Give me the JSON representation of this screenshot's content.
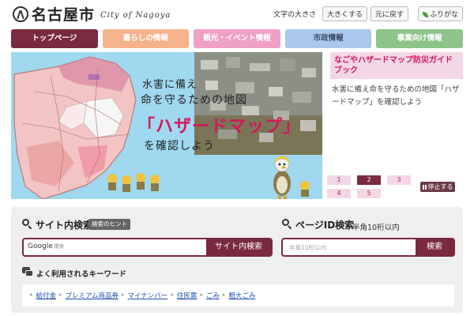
{
  "header": {
    "logo_text": "名古屋市",
    "logo_en": "City of Nagoya",
    "text_size_label": "文字の大きさ",
    "enlarge_label": "大きくする",
    "reset_label": "元に戻す",
    "furigana_label": "ふりがな"
  },
  "nav": {
    "items": [
      {
        "label": "トップページ"
      },
      {
        "label": "暮らしの情報"
      },
      {
        "label": "観光・イベント情報"
      },
      {
        "label": "市政情報"
      },
      {
        "label": "事業向け情報"
      }
    ]
  },
  "hero": {
    "line1": "水害に備え",
    "line2": "命を守るための地図",
    "line3": "「ハザードマップ」",
    "line4": "を確認しよう",
    "slide_title": "なごやハザードマップ防災ガイドブック",
    "slide_desc": "水害に備え命を守るための地図「ハザードマップ」を確認しよう",
    "pages": [
      "1",
      "2",
      "3",
      "4",
      "5"
    ],
    "active_page": 2,
    "stop_label": "停止する"
  },
  "site_search": {
    "title": "サイト内検索",
    "hint_label": "検索のヒント",
    "google_label": "Google",
    "google_sub": "提供",
    "submit_label": "サイト内検索"
  },
  "id_search": {
    "title": "ページID検索",
    "note": "半角10桁以内",
    "placeholder": "半角10桁以内",
    "submit_label": "検索"
  },
  "keywords": {
    "title": "よく利用されるキーワード",
    "items": [
      "給付金",
      "プレミアム商品券",
      "マイナンバー",
      "住民票",
      "ごみ",
      "粗大ごみ"
    ]
  },
  "colors": {
    "brand": "#7a2a3e",
    "accent_pink": "#d6175a",
    "hero_bg": "#9fd8ef",
    "link": "#1f4fb0"
  }
}
